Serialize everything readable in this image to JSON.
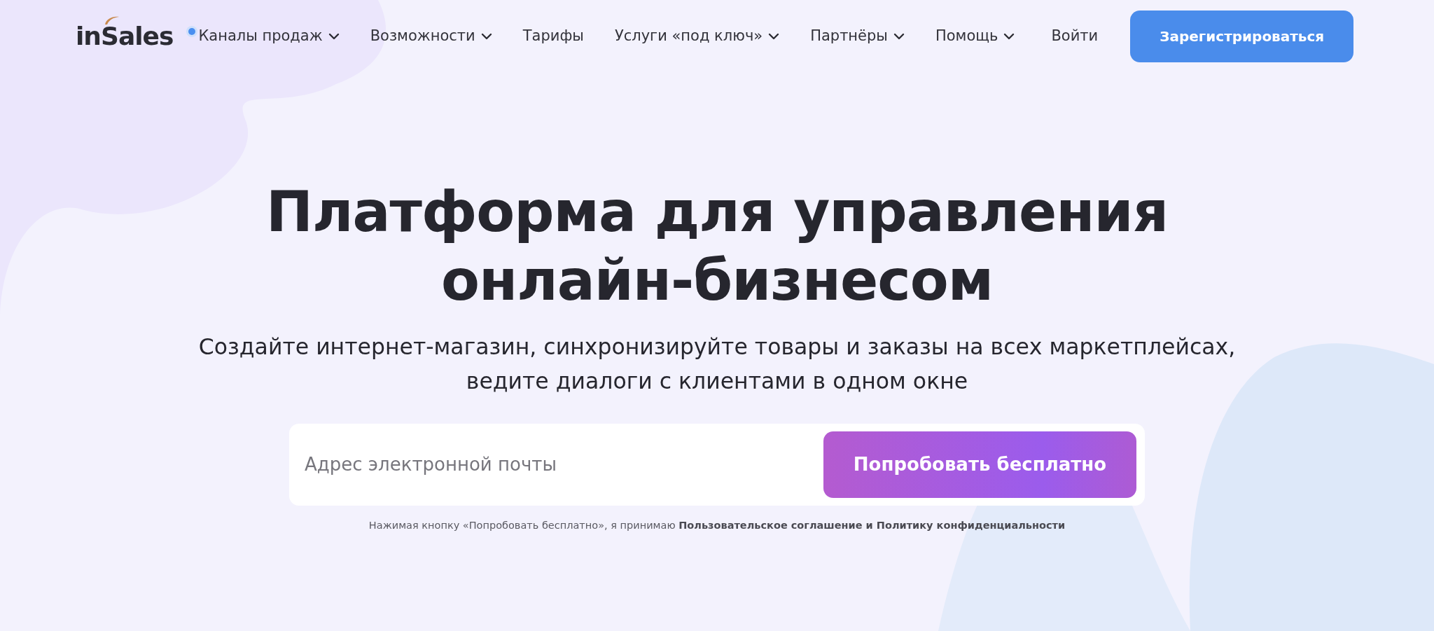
{
  "header": {
    "logo": "inSales",
    "nav": [
      {
        "label": "Каналы продаж",
        "dropdown": true,
        "dot": true
      },
      {
        "label": "Возможности",
        "dropdown": true,
        "dot": false
      },
      {
        "label": "Тарифы",
        "dropdown": false,
        "dot": false
      },
      {
        "label": "Услуги «под ключ»",
        "dropdown": true,
        "dot": false
      },
      {
        "label": "Партнёры",
        "dropdown": true,
        "dot": false
      },
      {
        "label": "Помощь",
        "dropdown": true,
        "dot": false
      }
    ],
    "login": "Войти",
    "register": "Зарегистрироваться"
  },
  "hero": {
    "title_lines": [
      "Платформа для управления",
      "онлайн-бизнесом"
    ],
    "subtitle_lines": [
      "Создайте интернет-магазин, синхронизируйте товары и заказы на всех маркетплейсах,",
      "ведите диалоги с клиентами в одном окне"
    ],
    "form": {
      "placeholder": "Адрес электронной почты",
      "button": "Попробовать бесплатно"
    },
    "consent": {
      "text": "Нажимая кнопку «Попробовать бесплатно», я принимаю",
      "link": "Пользовательское соглашение и Политику конфиденциальности"
    }
  }
}
